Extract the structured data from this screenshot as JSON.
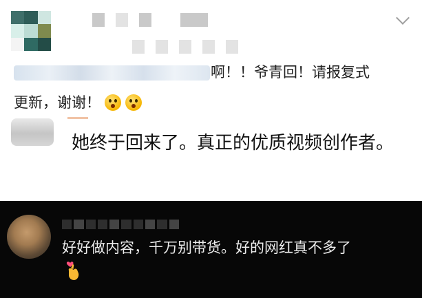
{
  "comments": [
    {
      "text_line1": "啊！！爷青回！请报复式",
      "text_line2": "更新，谢谢！",
      "emojis": [
        "shocked-face-icon",
        "shocked-face-icon"
      ]
    },
    {
      "text": "她终于回来了。真正的优质视频创作者。"
    },
    {
      "text": "好好做内容，千万别带货。好的网红真不多了",
      "emoji": "finger-heart-icon"
    }
  ],
  "colors": {
    "bottom_background": "#070707",
    "top_background": "#ffffff",
    "text_dark": "#111111",
    "text_light": "#ececec"
  }
}
